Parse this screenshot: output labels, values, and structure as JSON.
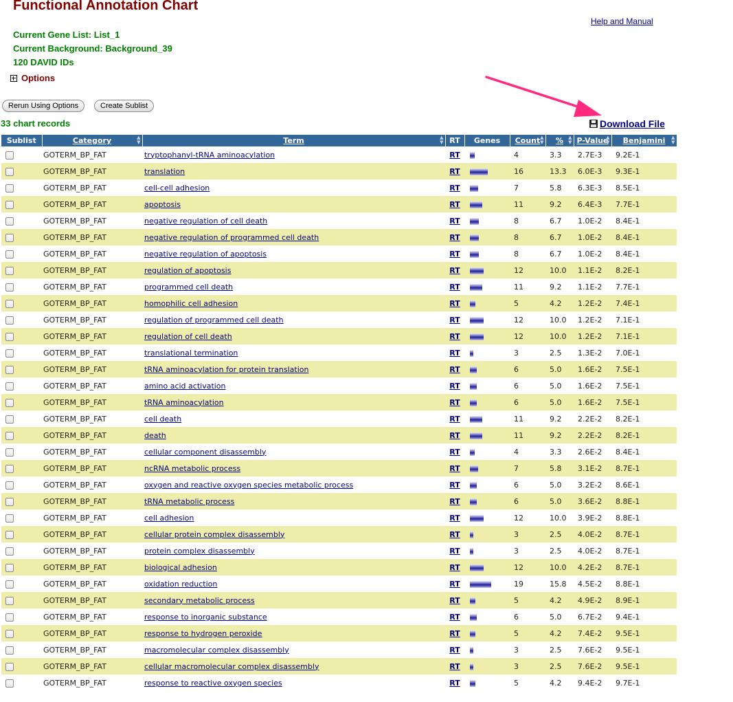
{
  "page": {
    "title": "Functional Annotation Chart",
    "help_link": "Help and Manual",
    "gene_list": "Current Gene List: List_1",
    "background": "Current Background: Background_39",
    "david_ids": "120 DAVID IDs",
    "options_label": "Options",
    "rerun_button": "Rerun Using Options",
    "sublist_button": "Create Sublist",
    "records_count": "33 chart records",
    "download_label": "Download File"
  },
  "colors": {
    "header_bg": "#336699",
    "alt_row": "#eeeeaa",
    "title": "#800000",
    "info": "#008000",
    "link": "#00008b",
    "arrow": "#ff2a7f"
  },
  "table": {
    "headers": [
      "Sublist",
      "Category",
      "Term",
      "RT",
      "Genes",
      "Count",
      "%",
      "P-Value",
      "Benjamini"
    ],
    "rt_label": "RT",
    "rows": [
      {
        "category": "GOTERM_BP_FAT",
        "term": "tryptophanyl-tRNA aminoacylation",
        "count": "4",
        "pct": "3.3",
        "pvalue": "2.7E-3",
        "benjamini": "9.2E-1"
      },
      {
        "category": "GOTERM_BP_FAT",
        "term": "translation",
        "count": "16",
        "pct": "13.3",
        "pvalue": "6.0E-3",
        "benjamini": "9.3E-1"
      },
      {
        "category": "GOTERM_BP_FAT",
        "term": "cell-cell adhesion",
        "count": "7",
        "pct": "5.8",
        "pvalue": "6.3E-3",
        "benjamini": "8.5E-1"
      },
      {
        "category": "GOTERM_BP_FAT",
        "term": "apoptosis",
        "count": "11",
        "pct": "9.2",
        "pvalue": "6.4E-3",
        "benjamini": "7.7E-1"
      },
      {
        "category": "GOTERM_BP_FAT",
        "term": "negative regulation of cell death",
        "count": "8",
        "pct": "6.7",
        "pvalue": "1.0E-2",
        "benjamini": "8.4E-1"
      },
      {
        "category": "GOTERM_BP_FAT",
        "term": "negative regulation of programmed cell death",
        "count": "8",
        "pct": "6.7",
        "pvalue": "1.0E-2",
        "benjamini": "8.4E-1"
      },
      {
        "category": "GOTERM_BP_FAT",
        "term": "negative regulation of apoptosis",
        "count": "8",
        "pct": "6.7",
        "pvalue": "1.0E-2",
        "benjamini": "8.4E-1"
      },
      {
        "category": "GOTERM_BP_FAT",
        "term": "regulation of apoptosis",
        "count": "12",
        "pct": "10.0",
        "pvalue": "1.1E-2",
        "benjamini": "8.2E-1"
      },
      {
        "category": "GOTERM_BP_FAT",
        "term": "programmed cell death",
        "count": "11",
        "pct": "9.2",
        "pvalue": "1.1E-2",
        "benjamini": "7.7E-1"
      },
      {
        "category": "GOTERM_BP_FAT",
        "term": "homophilic cell adhesion",
        "count": "5",
        "pct": "4.2",
        "pvalue": "1.2E-2",
        "benjamini": "7.4E-1"
      },
      {
        "category": "GOTERM_BP_FAT",
        "term": "regulation of programmed cell death",
        "count": "12",
        "pct": "10.0",
        "pvalue": "1.2E-2",
        "benjamini": "7.1E-1"
      },
      {
        "category": "GOTERM_BP_FAT",
        "term": "regulation of cell death",
        "count": "12",
        "pct": "10.0",
        "pvalue": "1.2E-2",
        "benjamini": "7.1E-1"
      },
      {
        "category": "GOTERM_BP_FAT",
        "term": "translational termination",
        "count": "3",
        "pct": "2.5",
        "pvalue": "1.3E-2",
        "benjamini": "7.0E-1"
      },
      {
        "category": "GOTERM_BP_FAT",
        "term": "tRNA aminoacylation for protein translation",
        "count": "6",
        "pct": "5.0",
        "pvalue": "1.6E-2",
        "benjamini": "7.5E-1"
      },
      {
        "category": "GOTERM_BP_FAT",
        "term": "amino acid activation",
        "count": "6",
        "pct": "5.0",
        "pvalue": "1.6E-2",
        "benjamini": "7.5E-1"
      },
      {
        "category": "GOTERM_BP_FAT",
        "term": "tRNA aminoacylation",
        "count": "6",
        "pct": "5.0",
        "pvalue": "1.6E-2",
        "benjamini": "7.5E-1"
      },
      {
        "category": "GOTERM_BP_FAT",
        "term": "cell death",
        "count": "11",
        "pct": "9.2",
        "pvalue": "2.2E-2",
        "benjamini": "8.2E-1"
      },
      {
        "category": "GOTERM_BP_FAT",
        "term": "death",
        "count": "11",
        "pct": "9.2",
        "pvalue": "2.2E-2",
        "benjamini": "8.2E-1"
      },
      {
        "category": "GOTERM_BP_FAT",
        "term": "cellular component disassembly",
        "count": "4",
        "pct": "3.3",
        "pvalue": "2.6E-2",
        "benjamini": "8.4E-1"
      },
      {
        "category": "GOTERM_BP_FAT",
        "term": "ncRNA metabolic process",
        "count": "7",
        "pct": "5.8",
        "pvalue": "3.1E-2",
        "benjamini": "8.7E-1"
      },
      {
        "category": "GOTERM_BP_FAT",
        "term": "oxygen and reactive oxygen species metabolic process",
        "count": "6",
        "pct": "5.0",
        "pvalue": "3.2E-2",
        "benjamini": "8.6E-1"
      },
      {
        "category": "GOTERM_BP_FAT",
        "term": "tRNA metabolic process",
        "count": "6",
        "pct": "5.0",
        "pvalue": "3.6E-2",
        "benjamini": "8.8E-1"
      },
      {
        "category": "GOTERM_BP_FAT",
        "term": "cell adhesion",
        "count": "12",
        "pct": "10.0",
        "pvalue": "3.9E-2",
        "benjamini": "8.8E-1"
      },
      {
        "category": "GOTERM_BP_FAT",
        "term": "cellular protein complex disassembly",
        "count": "3",
        "pct": "2.5",
        "pvalue": "4.0E-2",
        "benjamini": "8.7E-1"
      },
      {
        "category": "GOTERM_BP_FAT",
        "term": "protein complex disassembly",
        "count": "3",
        "pct": "2.5",
        "pvalue": "4.0E-2",
        "benjamini": "8.7E-1"
      },
      {
        "category": "GOTERM_BP_FAT",
        "term": "biological adhesion",
        "count": "12",
        "pct": "10.0",
        "pvalue": "4.2E-2",
        "benjamini": "8.7E-1"
      },
      {
        "category": "GOTERM_BP_FAT",
        "term": "oxidation reduction",
        "count": "19",
        "pct": "15.8",
        "pvalue": "4.5E-2",
        "benjamini": "8.8E-1"
      },
      {
        "category": "GOTERM_BP_FAT",
        "term": "secondary metabolic process",
        "count": "5",
        "pct": "4.2",
        "pvalue": "4.9E-2",
        "benjamini": "8.9E-1"
      },
      {
        "category": "GOTERM_BP_FAT",
        "term": "response to inorganic substance",
        "count": "6",
        "pct": "5.0",
        "pvalue": "6.7E-2",
        "benjamini": "9.4E-1"
      },
      {
        "category": "GOTERM_BP_FAT",
        "term": "response to hydrogen peroxide",
        "count": "5",
        "pct": "4.2",
        "pvalue": "7.4E-2",
        "benjamini": "9.5E-1"
      },
      {
        "category": "GOTERM_BP_FAT",
        "term": "macromolecular complex disassembly",
        "count": "3",
        "pct": "2.5",
        "pvalue": "7.6E-2",
        "benjamini": "9.5E-1"
      },
      {
        "category": "GOTERM_BP_FAT",
        "term": "cellular macromolecular complex disassembly",
        "count": "3",
        "pct": "2.5",
        "pvalue": "7.6E-2",
        "benjamini": "9.5E-1"
      },
      {
        "category": "GOTERM_BP_FAT",
        "term": "response to reactive oxygen species",
        "count": "5",
        "pct": "4.2",
        "pvalue": "9.4E-2",
        "benjamini": "9.7E-1"
      }
    ]
  }
}
